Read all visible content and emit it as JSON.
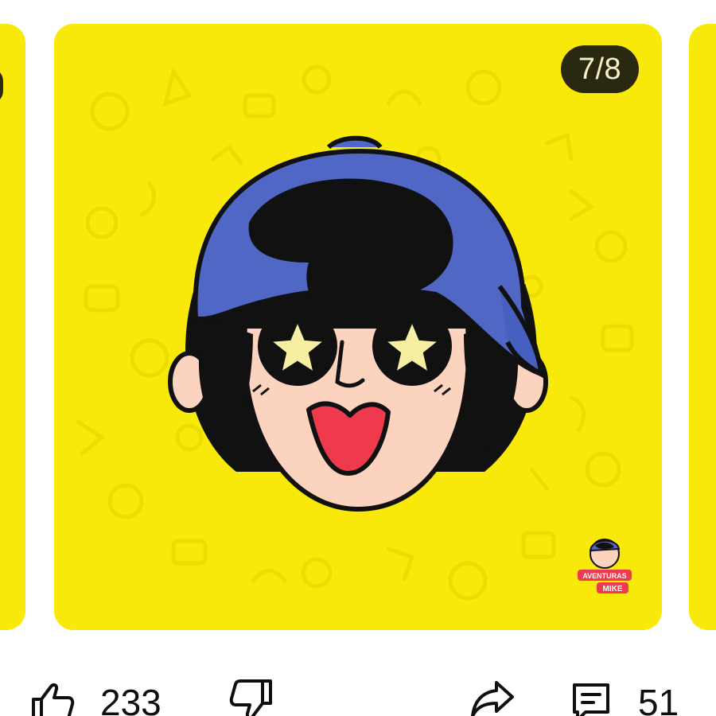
{
  "post": {
    "image_counter": "7/8",
    "watermark_text": "AVENTURAS DE MIKE"
  },
  "colors": {
    "card_yellow": "#f9e90a",
    "pattern": "#ecd900",
    "cap_blue": "#5067c6",
    "hair": "#111111",
    "skin": "#fcd3bf",
    "tongue": "#ef3a4e",
    "star": "#f6efa2"
  },
  "actions": {
    "like": {
      "icon": "thumbs-up-icon",
      "count": "233"
    },
    "dislike": {
      "icon": "thumbs-down-icon"
    },
    "share": {
      "icon": "share-icon"
    },
    "comments": {
      "icon": "comment-icon",
      "count": "51"
    }
  }
}
